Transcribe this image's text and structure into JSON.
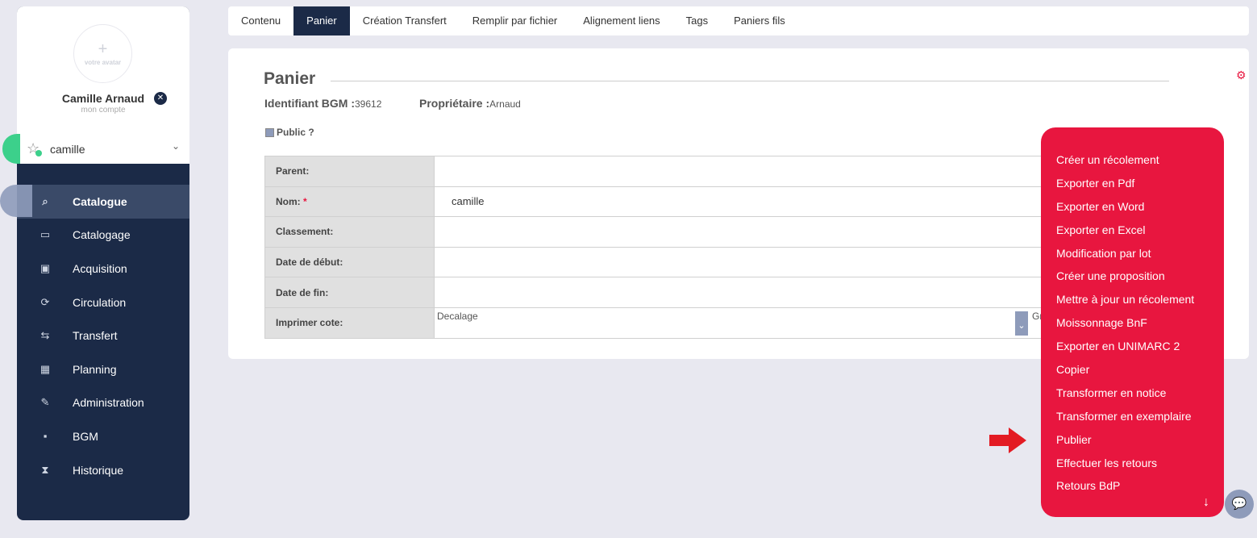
{
  "colors": {
    "sidebar_bg": "#1b2a47",
    "accent_red": "#e8163f",
    "online_green": "#3cd08b",
    "muted_blue": "#8e9bba"
  },
  "user": {
    "avatar_plus": "+",
    "avatar_label": "votre avatar",
    "name": "Camille Arnaud",
    "subtitle": "mon compte",
    "close_glyph": "✕",
    "profile_name": "camille",
    "star_glyph": "☆",
    "chevron_glyph": "⌄"
  },
  "nav": {
    "items": [
      {
        "label": "Catalogue",
        "icon": "catalogue-search-icon",
        "glyph": "⌕"
      },
      {
        "label": "Catalogage",
        "icon": "open-book-icon",
        "glyph": "▭"
      },
      {
        "label": "Acquisition",
        "icon": "box-icon",
        "glyph": "▣"
      },
      {
        "label": "Circulation",
        "icon": "refresh-icon",
        "glyph": "⟳"
      },
      {
        "label": "Transfert",
        "icon": "swap-arrows-icon",
        "glyph": "⇆"
      },
      {
        "label": "Planning",
        "icon": "calendar-icon",
        "glyph": "▦"
      },
      {
        "label": "Administration",
        "icon": "edit-icon",
        "glyph": "✎"
      },
      {
        "label": "BGM",
        "icon": "broken-image-icon",
        "glyph": "▪"
      },
      {
        "label": "Historique",
        "icon": "hourglass-icon",
        "glyph": "⧗"
      }
    ],
    "active_index": 0
  },
  "tabs": [
    "Contenu",
    "Panier",
    "Création Transfert",
    "Remplir par fichier",
    "Alignement liens",
    "Tags",
    "Paniers fils"
  ],
  "active_tab": 1,
  "card": {
    "title": "Panier",
    "gear_glyph": "⚙",
    "identifiant_label": "Identifiant BGM :",
    "identifiant_value": "39612",
    "proprietaire_label": "Propriétaire :",
    "proprietaire_value": "Arnaud",
    "public_label": "Public ?",
    "fields": {
      "parent_label": "Parent:",
      "parent_value": "",
      "nom_label": "Nom:",
      "nom_required": "*",
      "nom_value": "camille",
      "classement_label": "Classement:",
      "classement_value": "",
      "date_debut_label": "Date de début:",
      "date_debut_value": "",
      "date_fin_label": "Date de fin:",
      "date_fin_value": "",
      "imprimer_label": "Imprimer cote:",
      "imprimer_decalage": "Decalage",
      "imprimer_select_glyph": "⌄",
      "imprimer_trailing": "Gr"
    }
  },
  "actions_menu": {
    "items": [
      "Créer un récolement",
      "Exporter en Pdf",
      "Exporter en Word",
      "Exporter en Excel",
      "Modification par lot",
      "Créer une proposition",
      "Mettre à jour un récolement",
      "Moissonnage BnF",
      "Exporter en UNIMARC 2",
      "Copier",
      "Transformer en notice",
      "Transformer en exemplaire",
      "Publier",
      "Effectuer les retours",
      "Retours BdP"
    ],
    "scroll_glyph": "↓"
  },
  "chat_glyph": "💬"
}
